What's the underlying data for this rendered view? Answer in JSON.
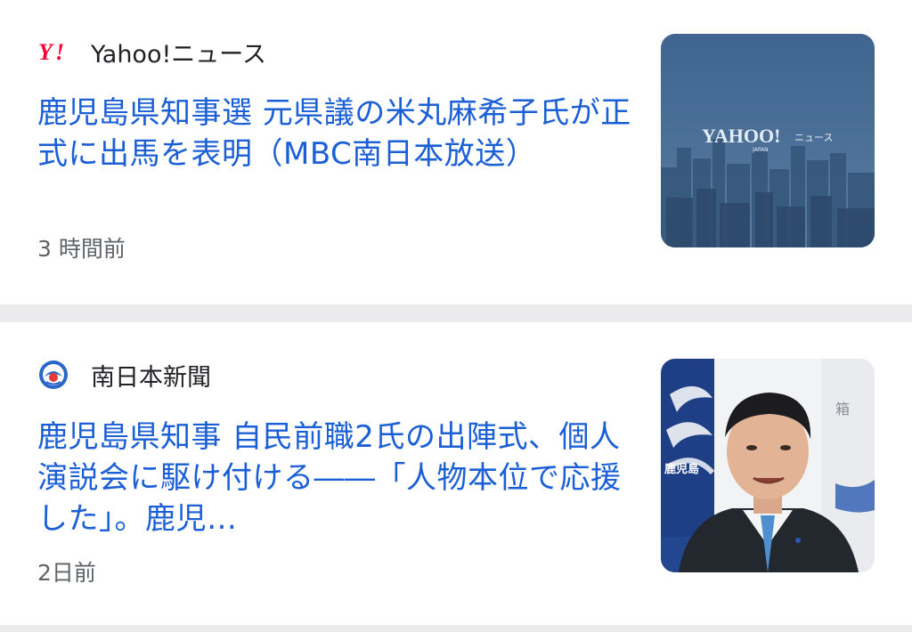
{
  "articles": [
    {
      "source": "Yahoo!ニュース",
      "source_icon": "yahoo-logo-icon",
      "headline": "鹿児島県知事選 元県議の米丸麻希子氏が正式に出馬を表明（MBC南日本放送）",
      "time": "3 時間前",
      "thumbnail": {
        "kind": "city-skyline-photo",
        "logo_text": "YAHOO!",
        "logo_suffix": "ニュース",
        "logo_sub": "JAPAN"
      }
    },
    {
      "source": "南日本新聞",
      "source_icon": "minaminippon-logo-icon",
      "headline": "鹿児島県知事 自民前職2氏の出陣式、個人演説会に駆け付ける――「人物本位で応援した」。鹿児…",
      "time": "2日前",
      "thumbnail": {
        "kind": "press-conference-photo",
        "backdrop_text": "鹿児島",
        "backdrop_text_right": "箱"
      }
    }
  ],
  "colors": {
    "headline": "#1a5fd6",
    "source_text": "#202124",
    "timestamp": "#5f6368",
    "divider": "#ebebed",
    "yahoo_red": "#ff0033"
  }
}
